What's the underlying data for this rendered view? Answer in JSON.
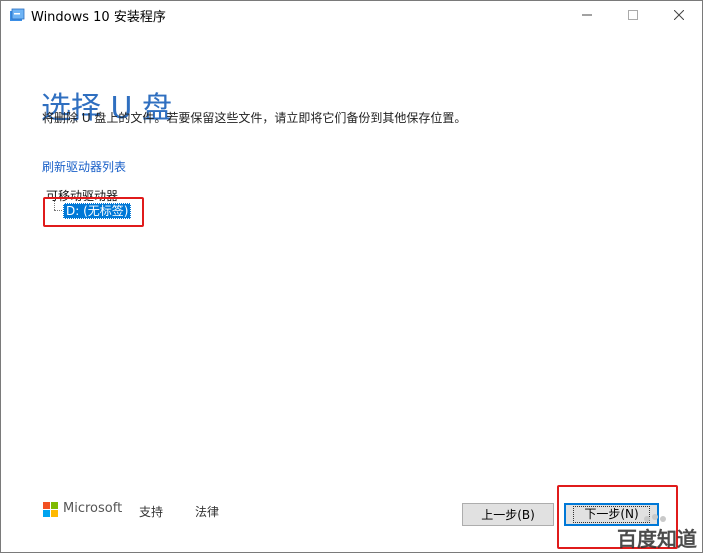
{
  "window": {
    "title": "Windows 10 安装程序",
    "icon": "setup-icon",
    "controls": {
      "minimize": "minimize-icon",
      "maximize": "maximize-icon",
      "close": "close-icon"
    }
  },
  "main": {
    "heading": "选择 U 盘",
    "subtitle": "将删除 U 盘上的文件。若要保留这些文件，请立即将它们备份到其他保存位置。",
    "refresh_link": "刷新驱动器列表",
    "tree": {
      "root_label": "可移动驱动器",
      "items": [
        {
          "label": "D: (无标签)",
          "selected": true
        }
      ]
    }
  },
  "footer": {
    "brand": "Microsoft",
    "support_link": "支持",
    "legal_link": "法律",
    "back_button": "上一步(B)",
    "next_button": "下一步(N)"
  },
  "watermark": {
    "text": "百度知道"
  },
  "colors": {
    "accent": "#2f6fc0",
    "link": "#1a60c8",
    "selection": "#0078d7",
    "annotation": "#e01b1b"
  }
}
